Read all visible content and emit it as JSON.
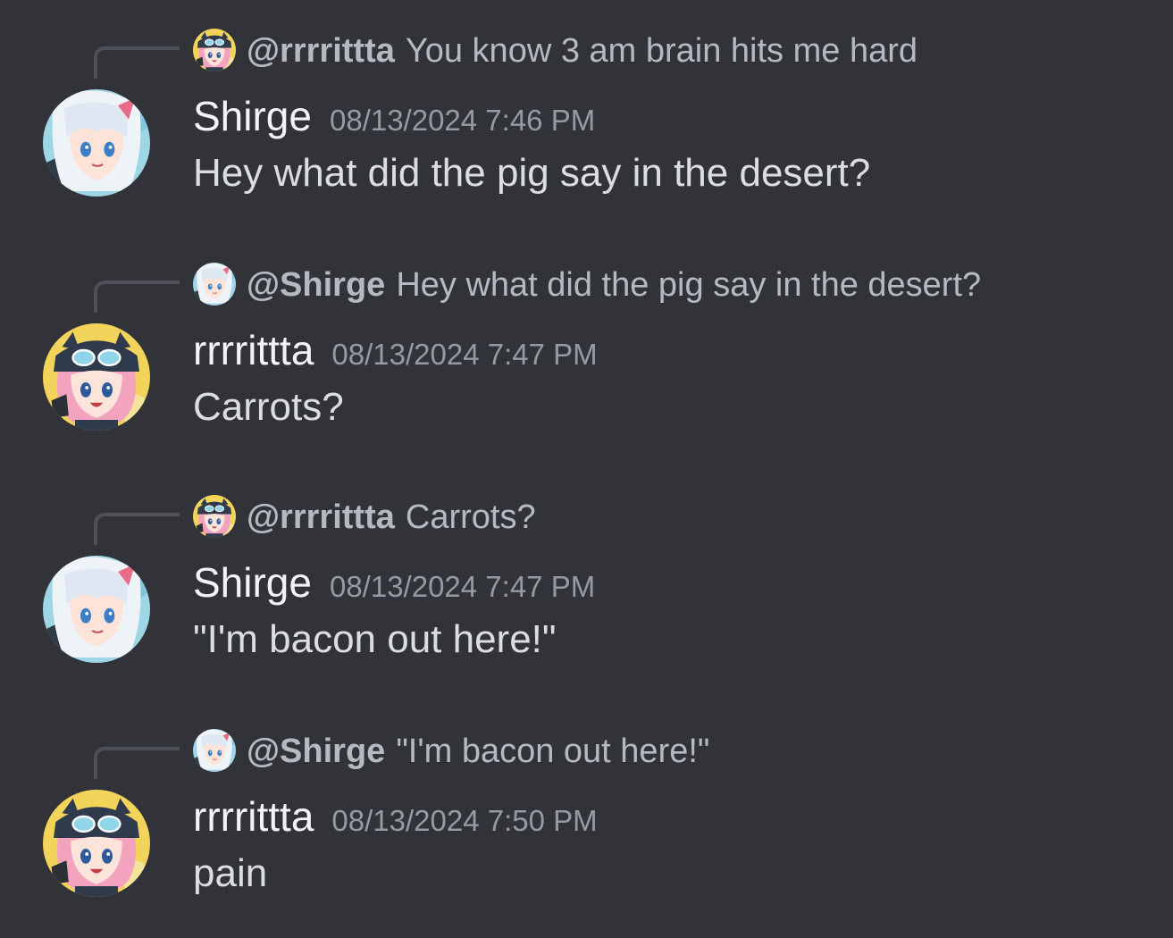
{
  "messages": [
    {
      "reply": {
        "mention": "@rrrrittta",
        "text": "You know 3 am brain hits me hard",
        "avatar_icon": "rrrrittta-avatar"
      },
      "author": "Shirge",
      "avatar_icon": "shirge-avatar",
      "timestamp": "08/13/2024 7:46 PM",
      "content": "Hey what did the pig say in the desert?"
    },
    {
      "reply": {
        "mention": "@Shirge",
        "text": "Hey what did the pig say in the desert?",
        "avatar_icon": "shirge-avatar"
      },
      "author": "rrrrittta",
      "avatar_icon": "rrrrittta-avatar",
      "timestamp": "08/13/2024 7:47 PM",
      "content": "Carrots?"
    },
    {
      "reply": {
        "mention": "@rrrrittta",
        "text": "Carrots?",
        "avatar_icon": "rrrrittta-avatar"
      },
      "author": "Shirge",
      "avatar_icon": "shirge-avatar",
      "timestamp": "08/13/2024 7:47 PM",
      "content": "\"I'm bacon out here!\""
    },
    {
      "reply": {
        "mention": "@Shirge",
        "text": "\"I'm bacon out here!\"",
        "avatar_icon": "shirge-avatar"
      },
      "author": "rrrrittta",
      "avatar_icon": "rrrrittta-avatar",
      "timestamp": "08/13/2024 7:50 PM",
      "content": "pain"
    }
  ],
  "colors": {
    "background": "#313338",
    "username": "#f2f3f5",
    "message_text": "#dbdee1",
    "muted_text": "#949ba4",
    "reply_text": "#b5bac1",
    "reply_spine": "#4e5058"
  }
}
